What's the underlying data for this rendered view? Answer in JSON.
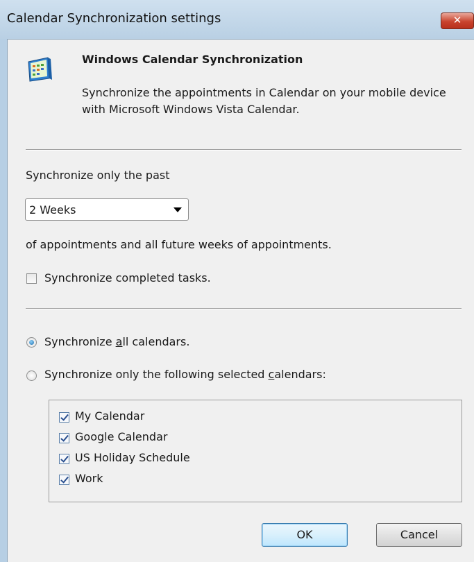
{
  "window": {
    "title": "Calendar Synchronization settings",
    "close_glyph": "✕"
  },
  "header": {
    "icon": "calendar-icon",
    "heading": "Windows Calendar Synchronization",
    "description": "Synchronize the appointments in Calendar on your mobile device with Microsoft Windows Vista Calendar."
  },
  "range": {
    "label": "Synchronize only the past",
    "selected_option": "2 Weeks",
    "suffix": "of appointments and all future weeks of appointments."
  },
  "tasks": {
    "label": "Synchronize completed tasks.",
    "checked": false
  },
  "calendars_mode": {
    "all_label_pre": "Synchronize ",
    "all_label_key": "a",
    "all_label_post": "ll calendars.",
    "all_selected": true,
    "some_label_pre": "Synchronize only the following selected ",
    "some_label_key": "c",
    "some_label_post": "alendars:",
    "some_selected": false
  },
  "calendars": [
    {
      "label": "My Calendar",
      "checked": true
    },
    {
      "label": "Google Calendar",
      "checked": true
    },
    {
      "label": "US Holiday Schedule",
      "checked": true
    },
    {
      "label": "Work",
      "checked": true
    }
  ],
  "buttons": {
    "ok": "OK",
    "cancel": "Cancel"
  }
}
